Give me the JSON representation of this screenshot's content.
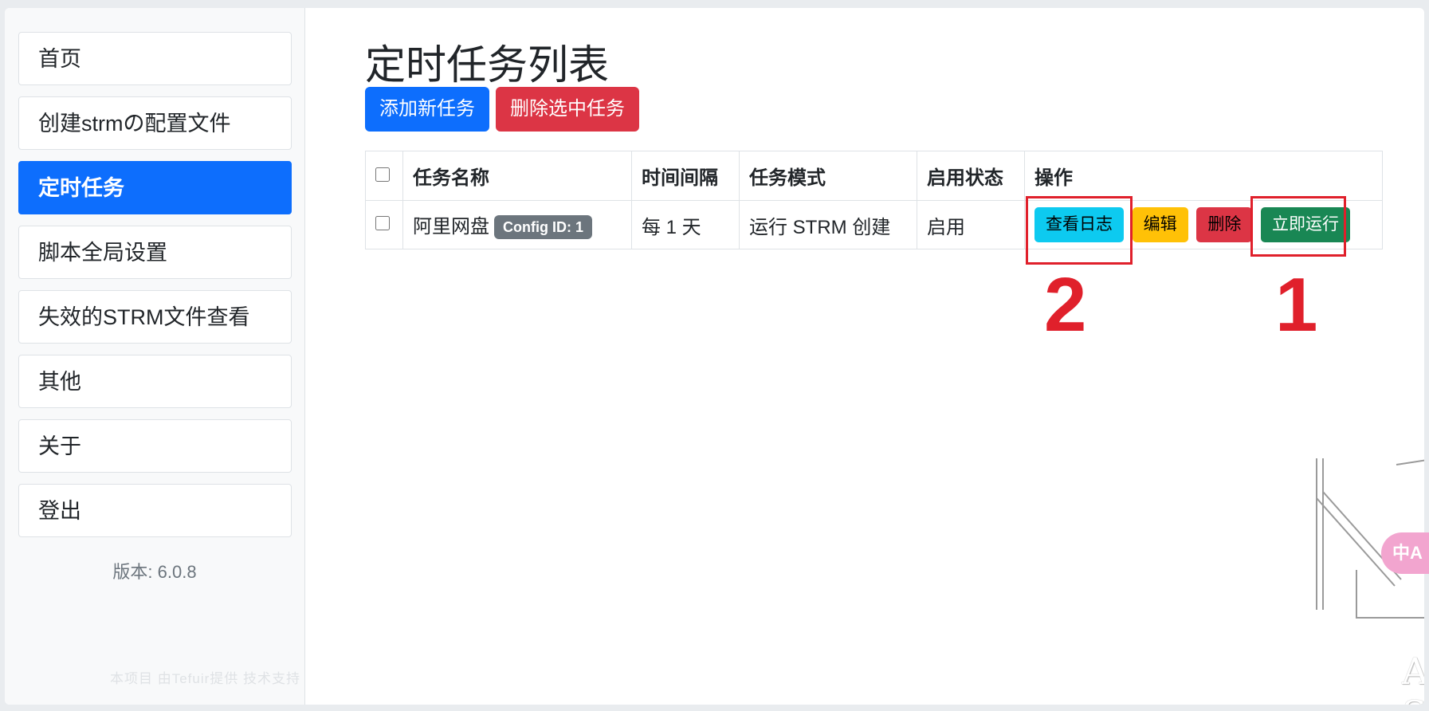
{
  "sidebar": {
    "items": [
      {
        "label": "首页"
      },
      {
        "label": "创建strmの配置文件"
      },
      {
        "label": "定时任务"
      },
      {
        "label": "脚本全局设置"
      },
      {
        "label": "失效的STRM文件查看"
      },
      {
        "label": "其他"
      },
      {
        "label": "关于"
      },
      {
        "label": "登出"
      }
    ],
    "active_index": 2,
    "version": "版本: 6.0.8",
    "footer": "本项目 由Tefuir提供 技术支持"
  },
  "main": {
    "title": "定时任务列表",
    "add_button": "添加新任务",
    "delete_selected_button": "删除选中任务",
    "table": {
      "headers": [
        "任务名称",
        "时间间隔",
        "任务模式",
        "启用状态",
        "操作"
      ],
      "rows": [
        {
          "name": "阿里网盘",
          "badge": "Config ID: 1",
          "interval": "每 1 天",
          "mode": "运行 STRM 创建",
          "status": "启用",
          "actions": {
            "view_log": "查看日志",
            "edit": "编辑",
            "delete": "删除",
            "run_now": "立即运行"
          }
        }
      ]
    }
  },
  "annotations": {
    "label_1": "1",
    "label_2": "2"
  },
  "watermark": {
    "text": "ALIST STRM"
  },
  "translate_icon": "中A",
  "colors": {
    "primary": "#0d6efd",
    "danger": "#dc3545",
    "info": "#0dcaf0",
    "warning": "#ffc107",
    "success": "#198754",
    "annotation": "#e0202b"
  }
}
